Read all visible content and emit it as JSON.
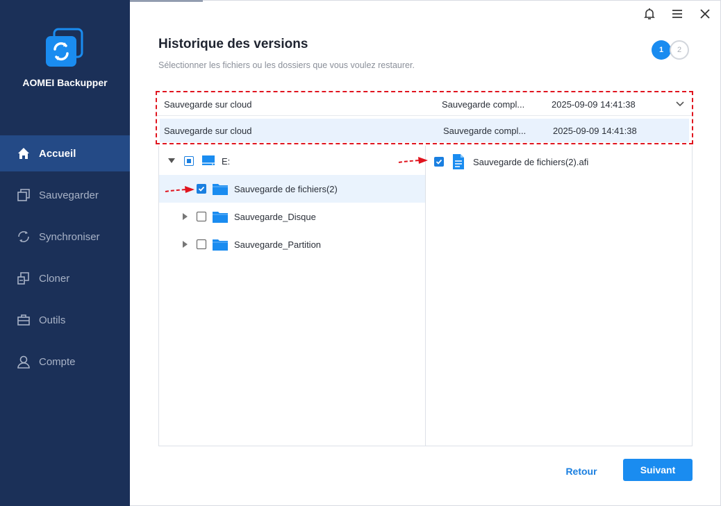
{
  "app": {
    "name": "AOMEI Backupper"
  },
  "nav": {
    "items": [
      {
        "label": "Accueil",
        "icon": "home-icon",
        "active": true
      },
      {
        "label": "Sauvegarder",
        "icon": "backup-icon",
        "active": false
      },
      {
        "label": "Synchroniser",
        "icon": "sync-icon",
        "active": false
      },
      {
        "label": "Cloner",
        "icon": "clone-icon",
        "active": false
      },
      {
        "label": "Outils",
        "icon": "toolbox-icon",
        "active": false
      },
      {
        "label": "Compte",
        "icon": "user-icon",
        "active": false
      }
    ]
  },
  "window_controls": [
    "bell-icon",
    "menu-icon",
    "close-icon"
  ],
  "header": {
    "title": "Historique des versions",
    "subtitle": "Sélectionner les fichiers ou les dossiers que vous voulez restaurer."
  },
  "steps": {
    "current": "1",
    "next": "2"
  },
  "versions": [
    {
      "name": "Sauvegarde sur cloud",
      "status": "Sauvegarde compl...",
      "date": "2025-09-09 14:41:38"
    },
    {
      "name": "Sauvegarde sur cloud",
      "status": "Sauvegarde compl...",
      "date": "2025-09-09 14:41:38"
    }
  ],
  "tree": {
    "root": {
      "label": "E:",
      "state": "partial"
    },
    "children": [
      {
        "label": "Sauvegarde de fichiers(2)",
        "checked": true,
        "selected": true,
        "expandable": false
      },
      {
        "label": "Sauvegarde_Disque",
        "checked": false,
        "selected": false,
        "expandable": true
      },
      {
        "label": "Sauvegarde_Partition",
        "checked": false,
        "selected": false,
        "expandable": true
      }
    ]
  },
  "files": [
    {
      "label": "Sauvegarde de fichiers(2).afi",
      "checked": true
    }
  ],
  "buttons": {
    "back": "Retour",
    "next": "Suivant"
  },
  "colors": {
    "sidebar": "#1b3058",
    "accent": "#1a8cf0",
    "annotation": "#e0141e"
  }
}
